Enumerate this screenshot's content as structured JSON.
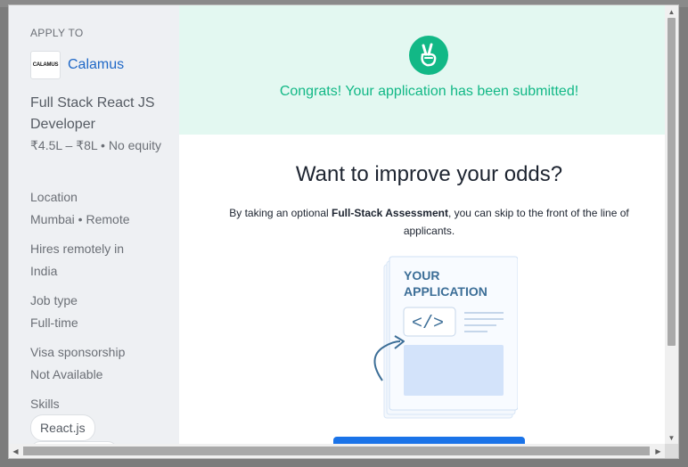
{
  "sidebar": {
    "apply_to_label": "APPLY TO",
    "company": {
      "logo_text": "CALAMUS",
      "name": "Calamus"
    },
    "job_title": "Full Stack React JS Developer",
    "salary": "₹4.5L – ₹8L • No equity",
    "fields": [
      {
        "label": "Location",
        "value": "Mumbai • Remote"
      },
      {
        "label": "Hires remotely in",
        "value": "India"
      },
      {
        "label": "Job type",
        "value": "Full-time"
      },
      {
        "label": "Visa sponsorship",
        "value": "Not Available"
      }
    ],
    "skills_label": "Skills",
    "skills": [
      "React.js"
    ]
  },
  "main": {
    "banner_text": "Congrats! Your application has been submitted!",
    "headline": "Want to improve your odds?",
    "desc_pre": "By taking an optional ",
    "desc_bold": "Full-Stack Assessment",
    "desc_post": ", you can skip to the front of the line of applicants.",
    "illustration": {
      "line1": "YOUR",
      "line2": "APPLICATION",
      "code_glyph": "</>"
    }
  },
  "colors": {
    "accent_green": "#12b886",
    "banner_bg": "#e3f8f1",
    "link_blue": "#1f68c7",
    "cta_blue": "#1a73e8"
  }
}
